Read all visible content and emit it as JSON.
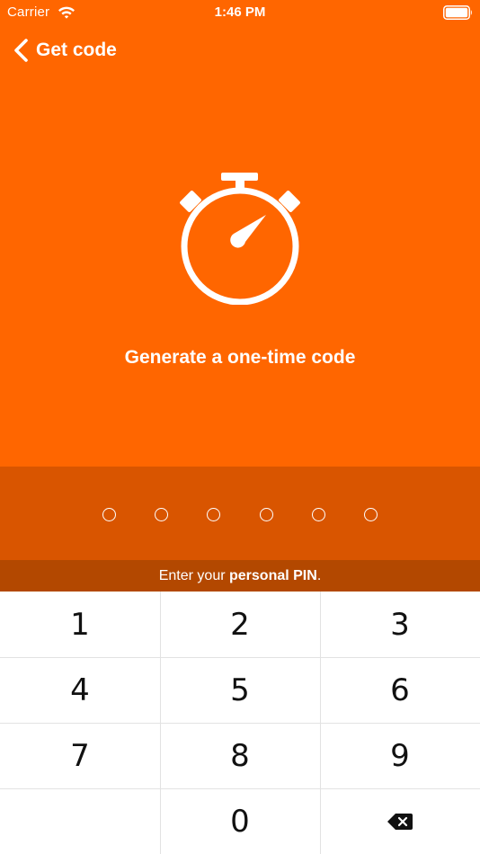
{
  "status_bar": {
    "carrier": "Carrier",
    "time": "1:46 PM"
  },
  "nav": {
    "back_label": "Get code"
  },
  "hero": {
    "title": "Generate a one-time code",
    "icon": "stopwatch-icon"
  },
  "pin": {
    "length": 6,
    "entered": 0,
    "hint_prefix": "Enter your ",
    "hint_bold": "personal PIN",
    "hint_suffix": "."
  },
  "keypad": {
    "rows": [
      [
        "1",
        "2",
        "3"
      ],
      [
        "4",
        "5",
        "6"
      ],
      [
        "7",
        "8",
        "9"
      ],
      [
        "",
        "0",
        "backspace-icon"
      ]
    ]
  },
  "colors": {
    "accent": "#FF6600",
    "pin_area": "#D95500",
    "hint_bar": "#B34800",
    "text_on_accent": "#FFFFFF"
  }
}
